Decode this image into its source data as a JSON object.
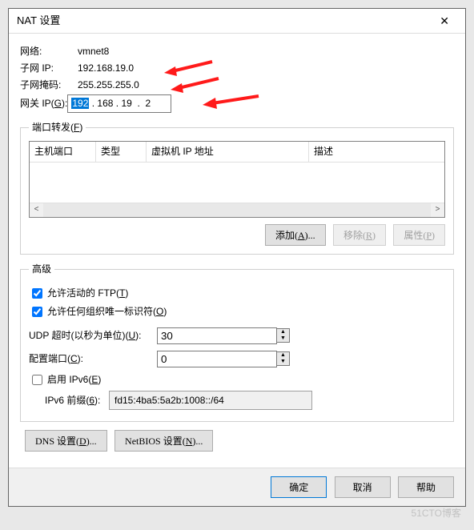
{
  "title": "NAT 设置",
  "network": {
    "label": "网络:",
    "value": "vmnet8"
  },
  "subnet_ip": {
    "label": "子网 IP:",
    "value": "192.168.19.0"
  },
  "subnet_mask": {
    "label": "子网掩码:",
    "value": "255.255.255.0"
  },
  "gateway": {
    "label": "网关 IP(",
    "mn": "G",
    "label2": "): ",
    "oct1": "192",
    "oct2": "168",
    "oct3": "19",
    "oct4": "2"
  },
  "port_fw": {
    "legend": "端口转发(",
    "mn": "F",
    "legend2": ")",
    "cols": {
      "host": "主机端口",
      "type": "类型",
      "vmip": "虚拟机 IP 地址",
      "desc": "描述"
    }
  },
  "btns": {
    "add": "添加(",
    "add_mn": "A",
    "add2": ")...",
    "remove": "移除(",
    "remove_mn": "R",
    "remove2": ")",
    "props": "属性(",
    "props_mn": "P",
    "props2": ")"
  },
  "adv": {
    "title": "高级",
    "ftp": "允许活动的 FTP(",
    "ftp_mn": "T",
    "ftp2": ")",
    "oui": "允许任何组织唯一标识符(",
    "oui_mn": "O",
    "oui2": ")",
    "udp": "UDP 超时(以秒为单位)(",
    "udp_mn": "U",
    "udp2": "):",
    "udp_val": "30",
    "cfgport": "配置端口(",
    "cfg_mn": "C",
    "cfg2": "):",
    "cfg_val": "0",
    "ipv6": "启用 IPv6(",
    "ipv6_mn": "E",
    "ipv62": ")",
    "prefix": "IPv6 前缀(",
    "pre_mn": "6",
    "pre2": "):",
    "prefix_val": "fd15:4ba5:5a2b:1008::/64"
  },
  "dns": {
    "dns": "DNS 设置(",
    "dns_mn": "D",
    "dns2": ")...",
    "nb": "NetBIOS 设置(",
    "nb_mn": "N",
    "nb2": ")..."
  },
  "footer": {
    "ok": "确定",
    "cancel": "取消",
    "help": "帮助"
  },
  "watermark": "51CTO博客"
}
